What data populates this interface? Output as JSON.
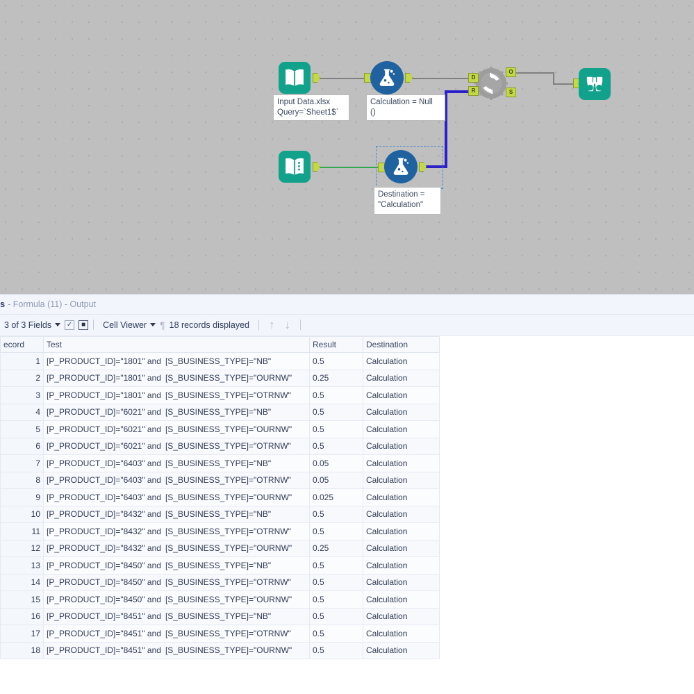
{
  "canvas": {
    "background_color": "#bfbfbf",
    "nodes": [
      {
        "id": "input-data",
        "icon": "book-icon",
        "type": "input-data-tool",
        "annotation": "Input Data.xlsx\nQuery=`Sheet1$`"
      },
      {
        "id": "formula-top",
        "icon": "flask-icon",
        "type": "formula-tool",
        "annotation": "Calculation = Null\n()"
      },
      {
        "id": "find-replace",
        "icon": "gear-refresh-icon",
        "type": "find-replace-tool",
        "annotation": ""
      },
      {
        "id": "browse",
        "icon": "binoculars-icon",
        "type": "browse-tool",
        "annotation": ""
      },
      {
        "id": "text-input",
        "icon": "book-lines-icon",
        "type": "text-input-tool",
        "annotation": ""
      },
      {
        "id": "formula-bottom",
        "icon": "flask-icon",
        "type": "formula-tool",
        "annotation": "Destination =\n\"Calculation\"",
        "selected": true
      }
    ],
    "port_labels": {
      "d": "D",
      "r": "R",
      "o": "O",
      "s": "S"
    },
    "wire_colors": {
      "default": "#808080",
      "green": "#2fa84f",
      "selected_blue": "#2b21c7"
    }
  },
  "results": {
    "title_strong": "ts",
    "title_rest": "- Formula (11) - Output",
    "toolbar": {
      "fields_label": "3 of 3 Fields",
      "select_all_icon": "checkbox-checked-icon",
      "deselect_all_icon": "checkbox-x-icon",
      "cell_viewer_label": "Cell Viewer",
      "pilcrow_icon": "pilcrow-icon",
      "records_label": "18 records displayed",
      "up_arrow_icon": "arrow-up-icon",
      "down_arrow_icon": "arrow-down-icon"
    },
    "columns": [
      "ecord",
      "Test",
      "Result",
      "Destination"
    ],
    "rows": [
      {
        "record": "1",
        "test_a": "[P_PRODUCT_ID]=\"1801\" and",
        "test_b": "[S_BUSINESS_TYPE]=\"NB\"",
        "result": "0.5",
        "destination": "Calculation"
      },
      {
        "record": "2",
        "test_a": "[P_PRODUCT_ID]=\"1801\" and",
        "test_b": "[S_BUSINESS_TYPE]=\"OURNW\"",
        "result": "0.25",
        "destination": "Calculation"
      },
      {
        "record": "3",
        "test_a": "[P_PRODUCT_ID]=\"1801\" and",
        "test_b": "[S_BUSINESS_TYPE]=\"OTRNW\"",
        "result": "0.5",
        "destination": "Calculation"
      },
      {
        "record": "4",
        "test_a": "[P_PRODUCT_ID]=\"6021\" and",
        "test_b": "[S_BUSINESS_TYPE]=\"NB\"",
        "result": "0.5",
        "destination": "Calculation"
      },
      {
        "record": "5",
        "test_a": "[P_PRODUCT_ID]=\"6021\" and",
        "test_b": "[S_BUSINESS_TYPE]=\"OURNW\"",
        "result": "0.5",
        "destination": "Calculation"
      },
      {
        "record": "6",
        "test_a": "[P_PRODUCT_ID]=\"6021\" and",
        "test_b": "[S_BUSINESS_TYPE]=\"OTRNW\"",
        "result": "0.5",
        "destination": "Calculation"
      },
      {
        "record": "7",
        "test_a": "[P_PRODUCT_ID]=\"6403\" and",
        "test_b": "[S_BUSINESS_TYPE]=\"NB\"",
        "result": "0.05",
        "destination": "Calculation"
      },
      {
        "record": "8",
        "test_a": "[P_PRODUCT_ID]=\"6403\" and",
        "test_b": "[S_BUSINESS_TYPE]=\"OTRNW\"",
        "result": "0.05",
        "destination": "Calculation"
      },
      {
        "record": "9",
        "test_a": "[P_PRODUCT_ID]=\"6403\" and",
        "test_b": "[S_BUSINESS_TYPE]=\"OURNW\"",
        "result": "0.025",
        "destination": "Calculation"
      },
      {
        "record": "10",
        "test_a": "[P_PRODUCT_ID]=\"8432\" and",
        "test_b": "[S_BUSINESS_TYPE]=\"NB\"",
        "result": "0.5",
        "destination": "Calculation"
      },
      {
        "record": "11",
        "test_a": "[P_PRODUCT_ID]=\"8432\" and",
        "test_b": "[S_BUSINESS_TYPE]=\"OTRNW\"",
        "result": "0.5",
        "destination": "Calculation"
      },
      {
        "record": "12",
        "test_a": "[P_PRODUCT_ID]=\"8432\" and",
        "test_b": "[S_BUSINESS_TYPE]=\"OURNW\"",
        "result": "0.25",
        "destination": "Calculation"
      },
      {
        "record": "13",
        "test_a": "[P_PRODUCT_ID]=\"8450\" and",
        "test_b": "[S_BUSINESS_TYPE]=\"NB\"",
        "result": "0.5",
        "destination": "Calculation"
      },
      {
        "record": "14",
        "test_a": "[P_PRODUCT_ID]=\"8450\" and",
        "test_b": "[S_BUSINESS_TYPE]=\"OTRNW\"",
        "result": "0.5",
        "destination": "Calculation"
      },
      {
        "record": "15",
        "test_a": "[P_PRODUCT_ID]=\"8450\" and",
        "test_b": "[S_BUSINESS_TYPE]=\"OURNW\"",
        "result": "0.5",
        "destination": "Calculation"
      },
      {
        "record": "16",
        "test_a": "[P_PRODUCT_ID]=\"8451\" and",
        "test_b": "[S_BUSINESS_TYPE]=\"NB\"",
        "result": "0.5",
        "destination": "Calculation"
      },
      {
        "record": "17",
        "test_a": "[P_PRODUCT_ID]=\"8451\" and",
        "test_b": "[S_BUSINESS_TYPE]=\"OTRNW\"",
        "result": "0.5",
        "destination": "Calculation"
      },
      {
        "record": "18",
        "test_a": "[P_PRODUCT_ID]=\"8451\" and",
        "test_b": "[S_BUSINESS_TYPE]=\"OURNW\"",
        "result": "0.5",
        "destination": "Calculation"
      }
    ]
  }
}
